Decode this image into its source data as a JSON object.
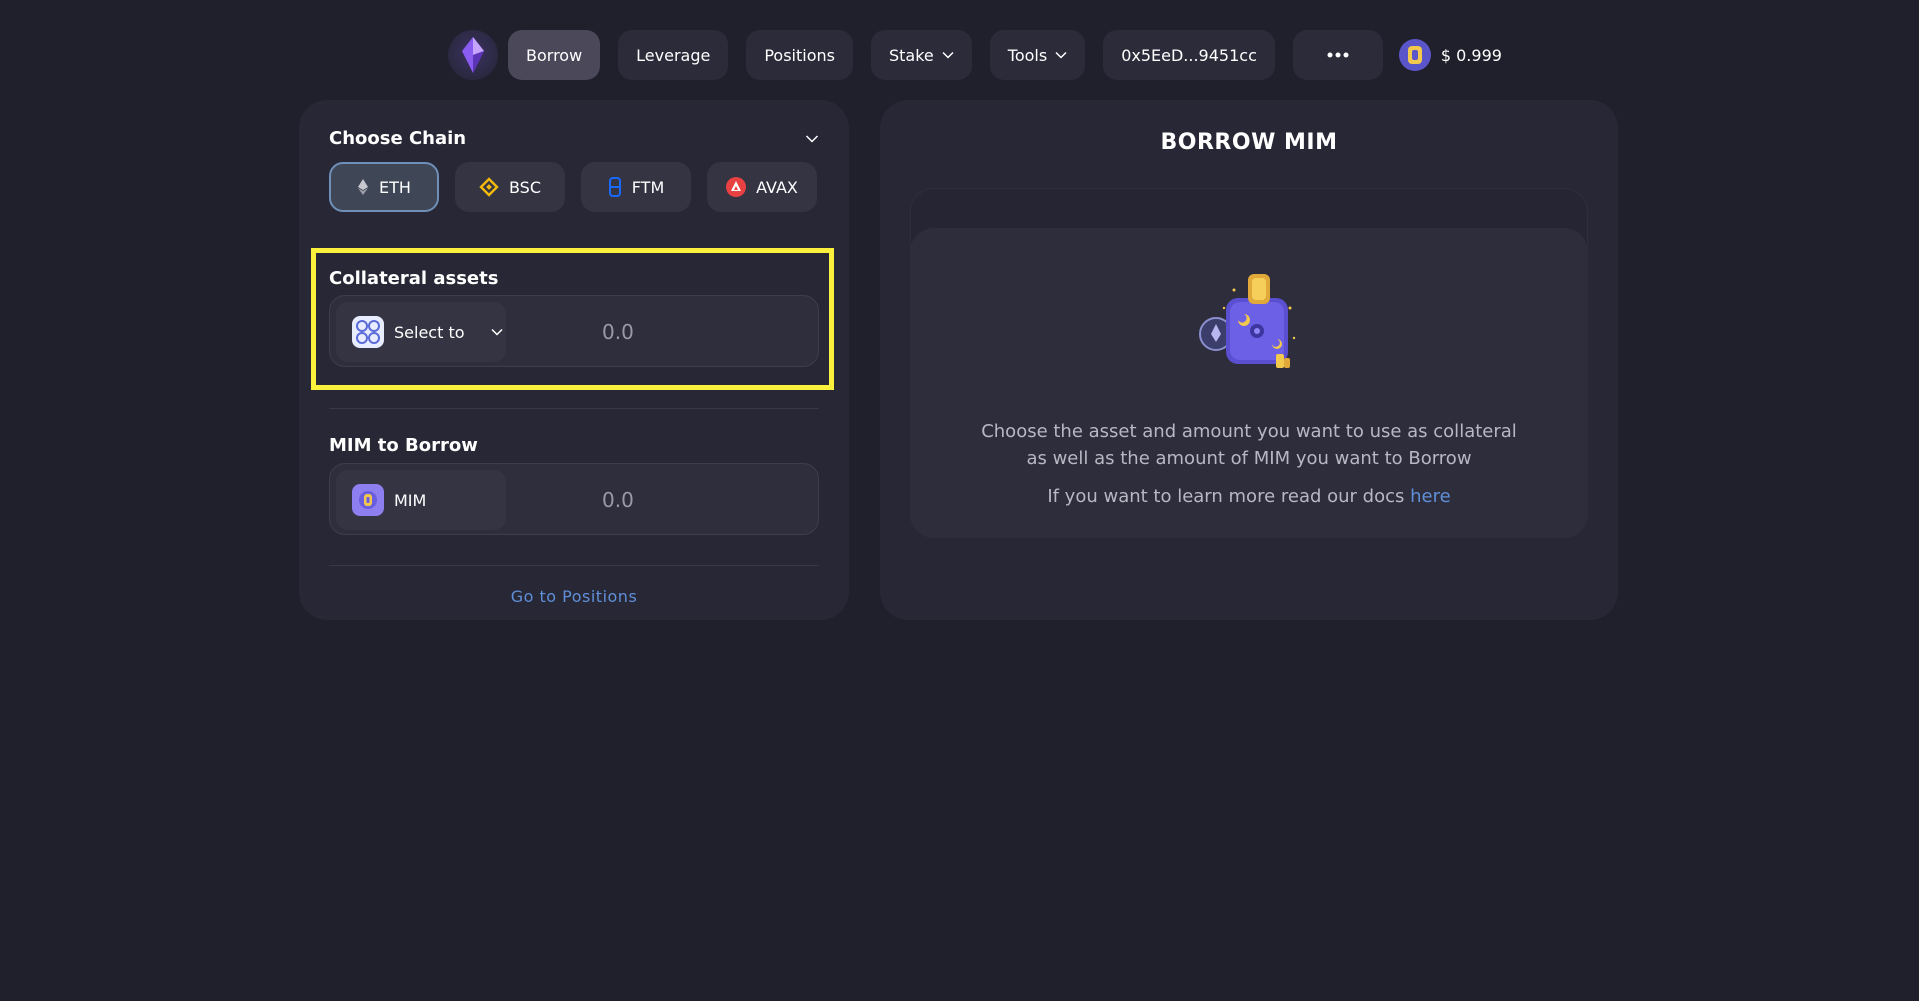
{
  "nav": {
    "logo_icon": "crystal-logo-icon",
    "items": [
      {
        "label": "Borrow",
        "active": true
      },
      {
        "label": "Leverage"
      },
      {
        "label": "Positions"
      },
      {
        "label": "Stake",
        "dropdown": true
      },
      {
        "label": "Tools",
        "dropdown": true
      }
    ],
    "wallet_address": "0x5EeD...9451cc",
    "more_icon": "ellipsis-icon",
    "price": "$ 0.999"
  },
  "borrow_form": {
    "chain_title": "Choose Chain",
    "chains": [
      {
        "label": "ETH",
        "icon": "ethereum-icon",
        "color": "#c8c8d0",
        "active": true
      },
      {
        "label": "BSC",
        "icon": "bnb-icon",
        "color": "#f0b90b"
      },
      {
        "label": "FTM",
        "icon": "fantom-icon",
        "color": "#1969ff"
      },
      {
        "label": "AVAX",
        "icon": "avalanche-icon",
        "color": "#e84142"
      }
    ],
    "collateral_title": "Collateral assets",
    "collateral_select_label": "Select to",
    "collateral_amount": "0.0",
    "mim_title": "MIM to Borrow",
    "mim_label": "MIM",
    "mim_amount": "0.0",
    "go_positions": "Go to Positions"
  },
  "info_panel": {
    "title": "BORROW MIM",
    "description": "Choose the asset and amount you want to use as collateral as well as the amount of MIM you want to Borrow",
    "docs_text": "If you want to learn more read our docs",
    "docs_link": "here"
  },
  "colors": {
    "background": "#201f2c",
    "panel": "#282735",
    "highlight": "#fbf03c",
    "link": "#5f8fd8"
  }
}
